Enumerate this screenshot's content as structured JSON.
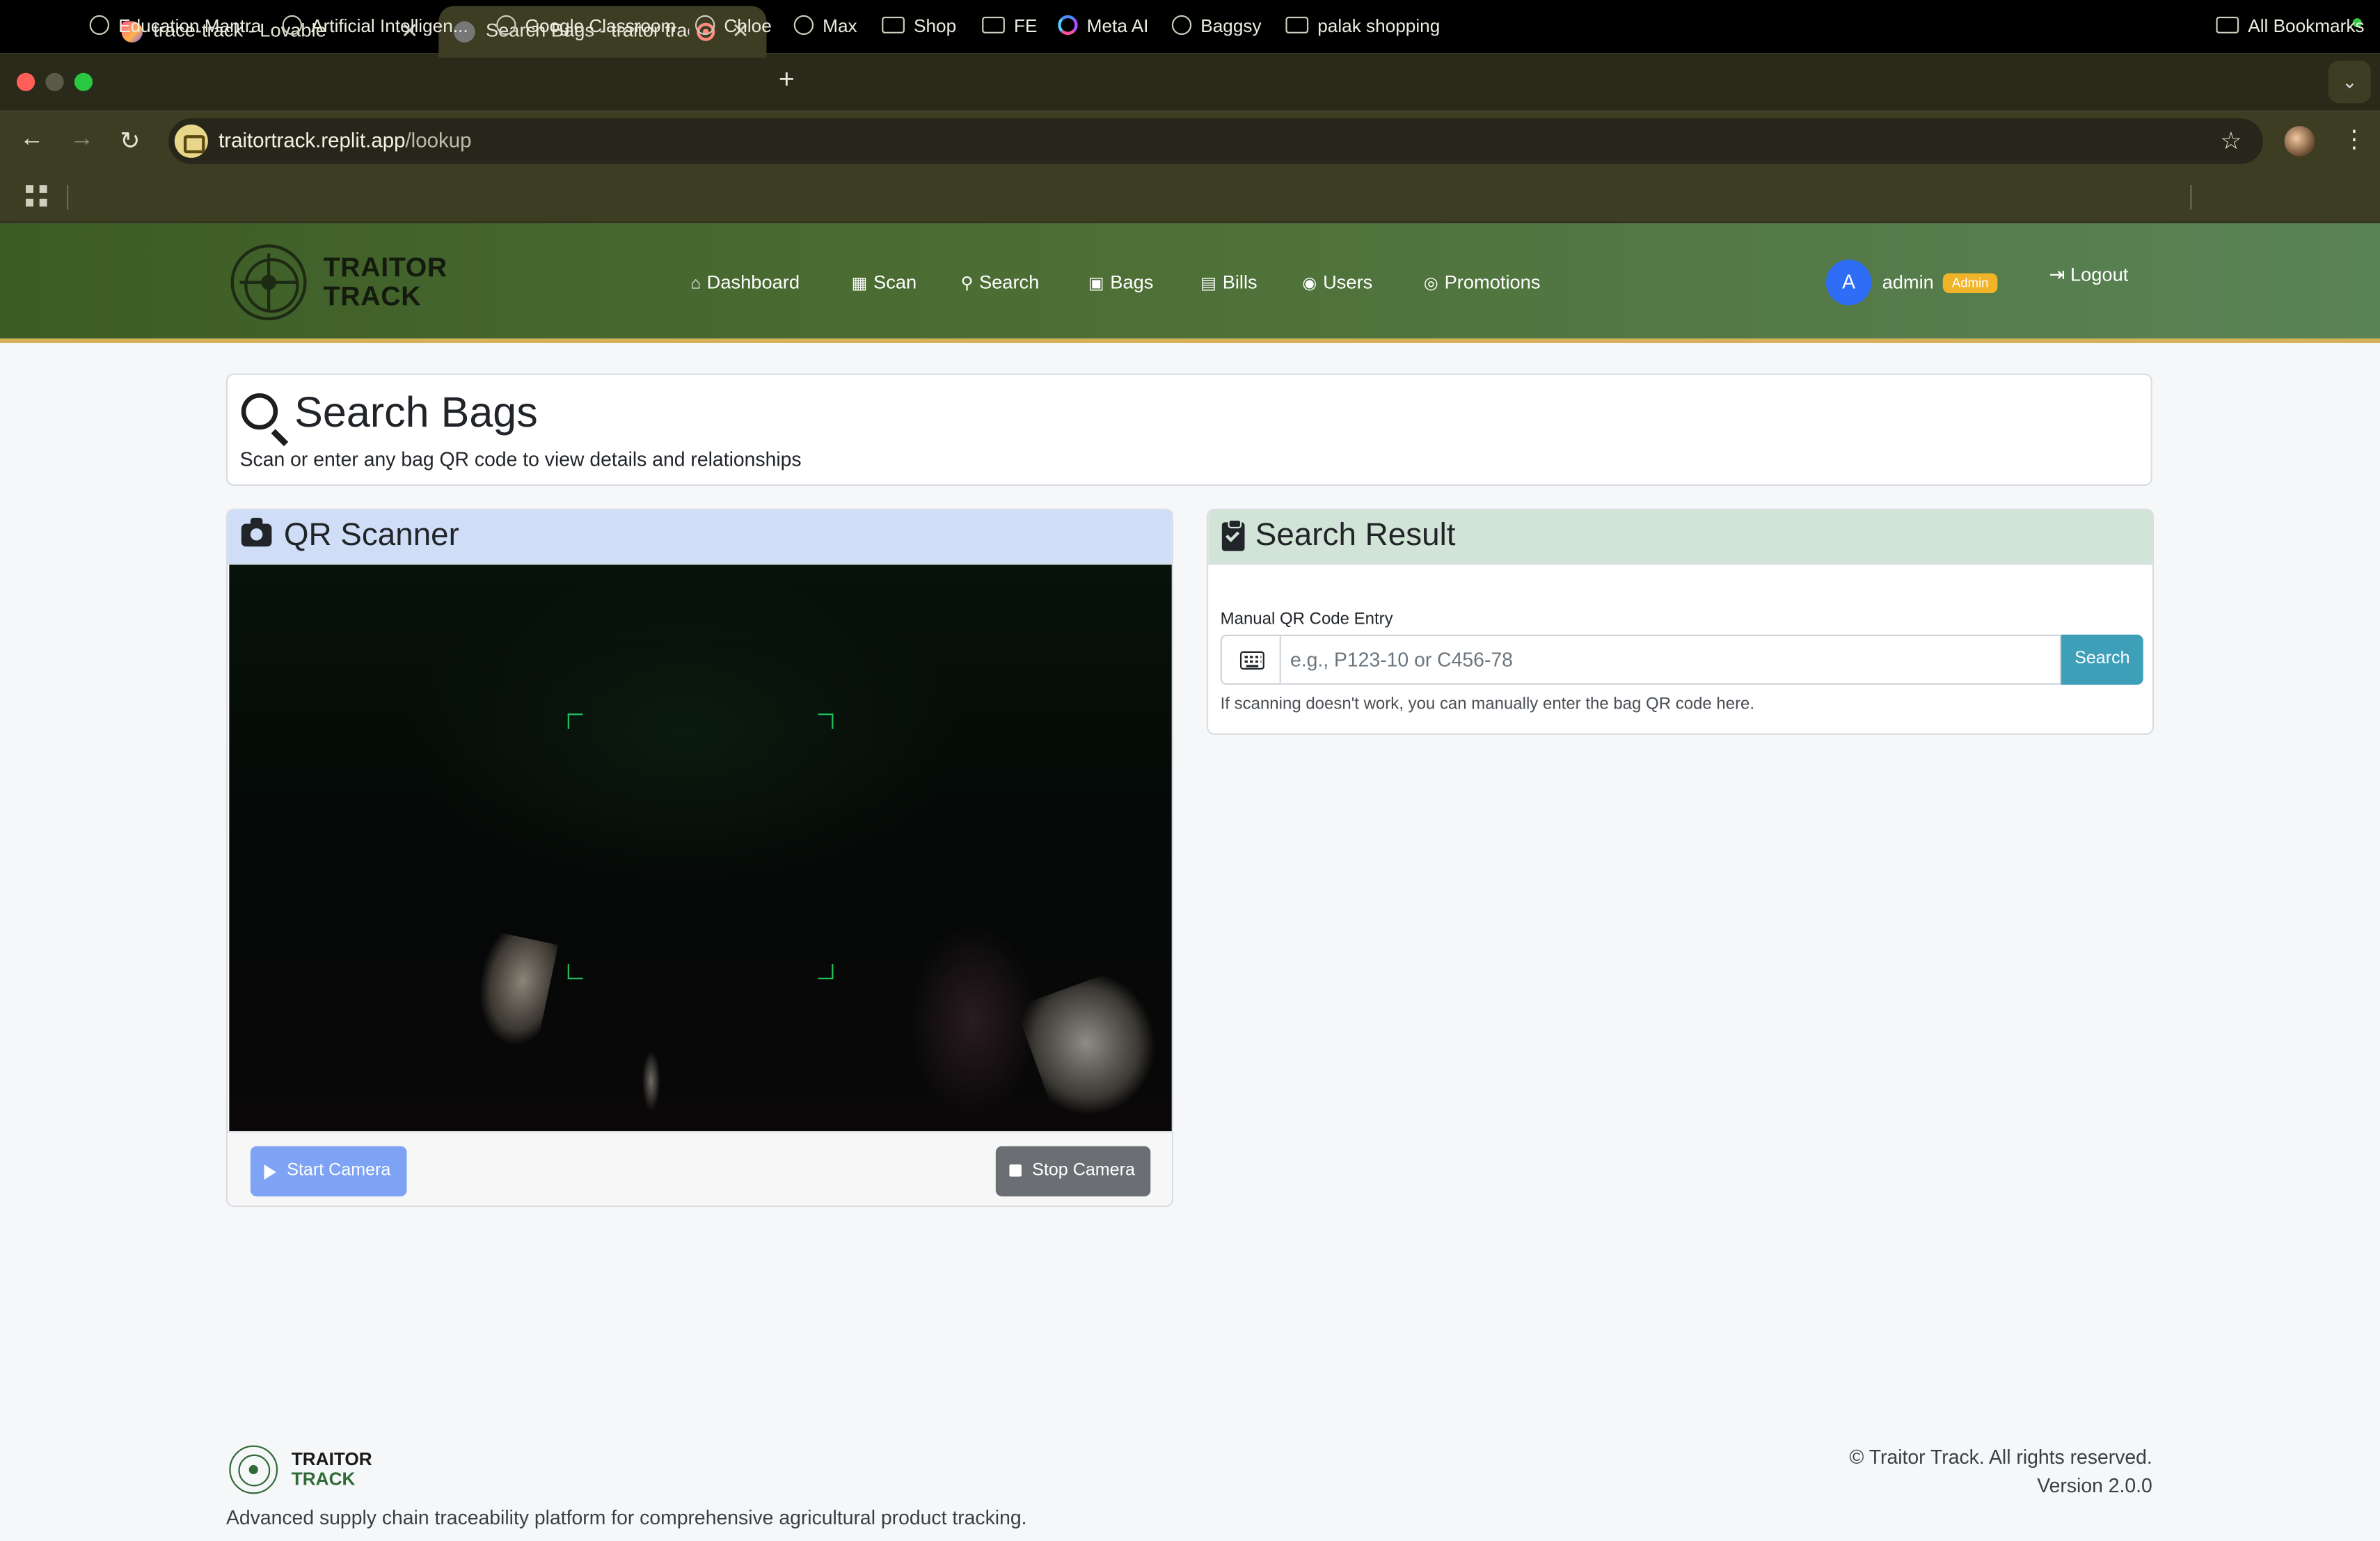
{
  "browser": {
    "tabs": [
      {
        "title": "trace-track - Lovable",
        "active": false
      },
      {
        "title": "Search Bags - traitor track",
        "active": true
      }
    ],
    "new_tab": "+",
    "url_host": "traitortrack.replit.app",
    "url_path": "/lookup",
    "bookmarks": [
      {
        "label": "Education Mantra",
        "icon": "globe-icon"
      },
      {
        "label": "Artificial Intelligen...",
        "icon": "globe-icon"
      },
      {
        "label": "Google Classroom",
        "icon": "globe-icon"
      },
      {
        "label": "Chloe",
        "icon": "globe-icon"
      },
      {
        "label": "Max",
        "icon": "globe-icon"
      },
      {
        "label": "Shop",
        "icon": "folder-icon"
      },
      {
        "label": "FE",
        "icon": "folder-icon"
      },
      {
        "label": "Meta AI",
        "icon": "meta-ai-icon"
      },
      {
        "label": "Baggsy",
        "icon": "openai-icon"
      },
      {
        "label": "palak shopping",
        "icon": "folder-icon"
      }
    ],
    "all_bookmarks": "All Bookmarks"
  },
  "nav": {
    "brand_line1": "TRAITOR",
    "brand_line2": "TRACK",
    "links": [
      {
        "label": "Dashboard",
        "icon": "home-icon"
      },
      {
        "label": "Scan",
        "icon": "qrcode-icon"
      },
      {
        "label": "Search",
        "icon": "search-icon"
      },
      {
        "label": "Bags",
        "icon": "boxes-icon"
      },
      {
        "label": "Bills",
        "icon": "file-icon"
      },
      {
        "label": "Users",
        "icon": "users-icon"
      },
      {
        "label": "Promotions",
        "icon": "user-cog-icon"
      }
    ],
    "avatar_letter": "A",
    "username": "admin",
    "role_badge": "Admin",
    "logout": "Logout"
  },
  "page": {
    "title": "Search Bags",
    "subtitle": "Scan or enter any bag QR code to view details and relationships"
  },
  "scanner": {
    "title": "QR Scanner",
    "start_button": "Start Camera",
    "stop_button": "Stop Camera"
  },
  "result": {
    "title": "Search Result",
    "field_label": "Manual QR Code Entry",
    "input_value": "",
    "input_placeholder": "e.g., P123-10 or C456-78",
    "search_button": "Search",
    "help_text": "If scanning doesn't work, you can manually enter the bag QR code here."
  },
  "footer": {
    "brand_line1": "TRAITOR",
    "brand_line2": "TRACK",
    "tagline": "Advanced supply chain traceability platform for comprehensive agricultural product tracking.",
    "copyright": "© Traitor Track. All rights reserved.",
    "version": "Version 2.0.0"
  },
  "colors": {
    "nav_gradient_start": "#3c5c25",
    "nav_gradient_end": "#5a8356",
    "nav_border": "#d6b15a",
    "scanner_header": "#cfddf7",
    "result_header": "#d2e4d7",
    "start_button": "#7ea3f4",
    "stop_button": "#6b6f73",
    "search_button": "#3e9fb8",
    "role_badge": "#f0b429",
    "avatar": "#2f6df6",
    "scan_corners": "#22c55e"
  }
}
